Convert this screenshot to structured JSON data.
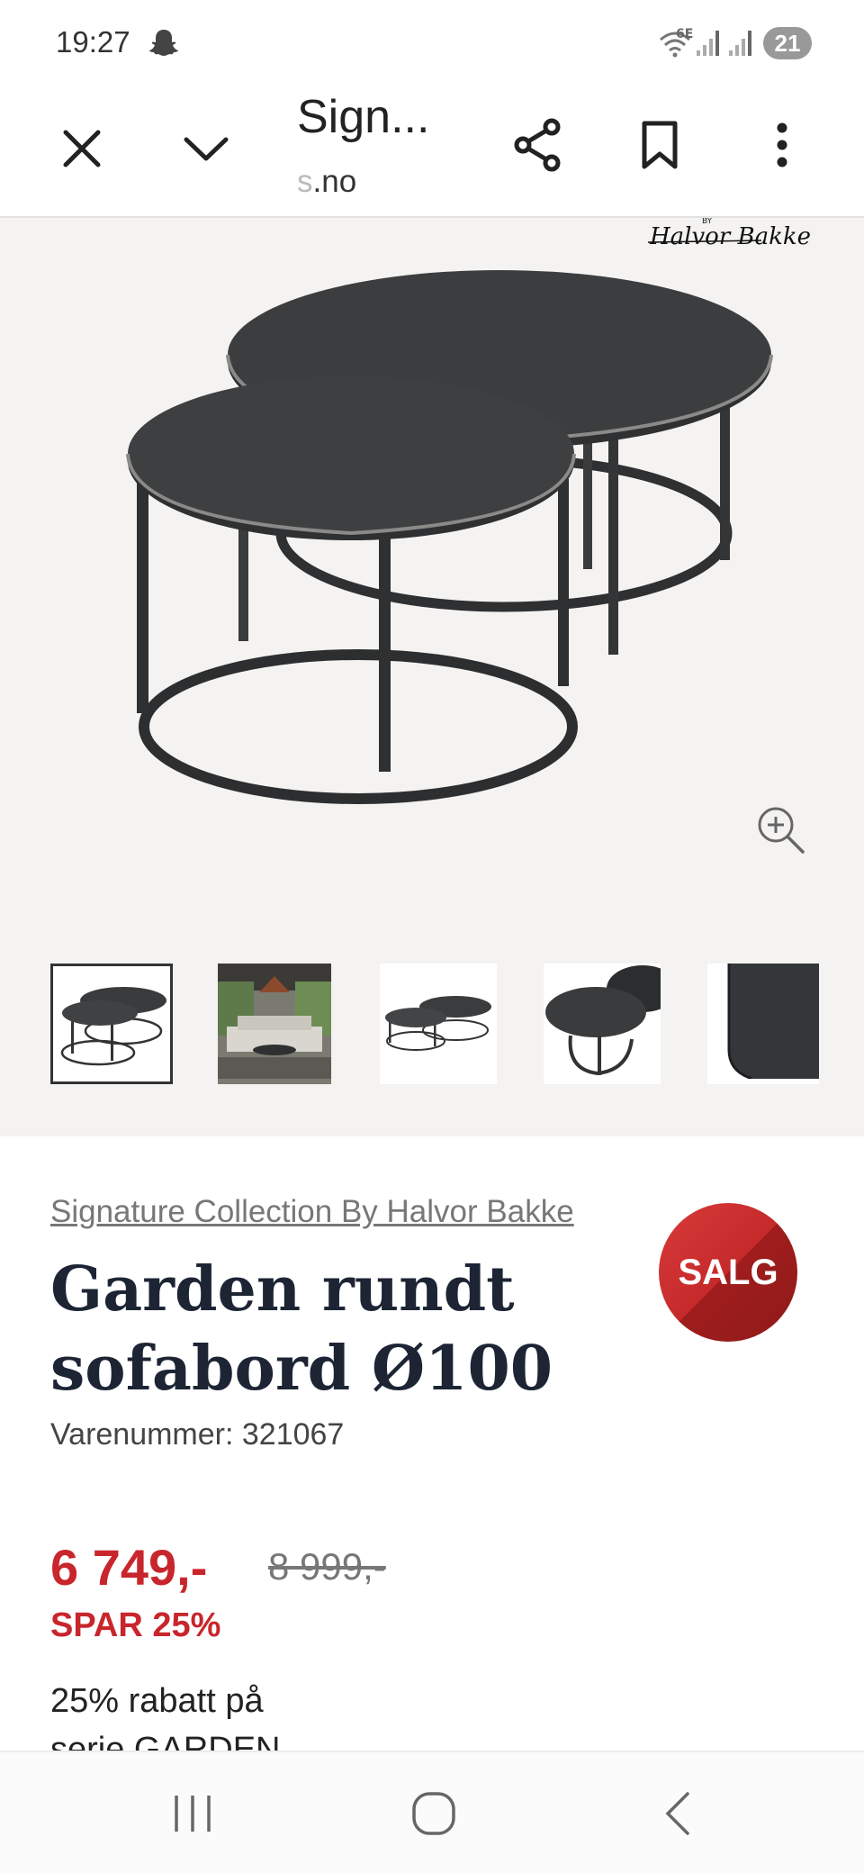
{
  "status_bar": {
    "time": "19:27",
    "network_label": "6E",
    "battery_level": "21",
    "icons": [
      "snapchat-icon",
      "wifi-icon",
      "signal-icon",
      "battery-icon"
    ]
  },
  "toolbar": {
    "title": "Sign...",
    "url_prefix": "s",
    "url": ".no",
    "icons": [
      "close-icon",
      "chevron-down-icon",
      "share-icon",
      "bookmark-icon",
      "more-vert-icon"
    ]
  },
  "gallery": {
    "logo_text": "Halvor Bakke",
    "logo_by": "BY",
    "thumbnail_count": 5,
    "active_thumbnail": 1
  },
  "product": {
    "brand": "Signature Collection By Halvor Bakke",
    "title_line1": "Garden rundt",
    "title_line2": "sofabord Ø100",
    "sale_badge": "SALG",
    "sku_label": "Varenummer: ",
    "sku": "321067",
    "price": "6 749,-",
    "old_price": "8 999,-",
    "save": "SPAR 25%",
    "promo_line1": "25% rabatt på",
    "promo_line2": "serie GARDEN"
  },
  "colors": {
    "accent_red": "#c8262c",
    "title_navy": "#1d2535",
    "gallery_bg": "#f4f3f1"
  },
  "nav": {
    "icons": [
      "recent-apps-icon",
      "home-icon",
      "back-icon"
    ]
  }
}
